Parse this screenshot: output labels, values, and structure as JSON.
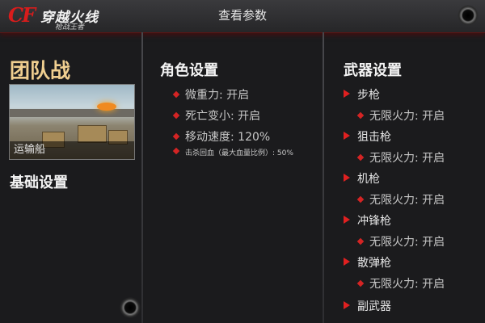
{
  "header": {
    "title": "查看参数",
    "logo_text": "穿越火线",
    "logo_sub": "枪战王者"
  },
  "mode": {
    "name": "团队战",
    "map_name": "运输船"
  },
  "basic_settings": {
    "title": "基础设置"
  },
  "role_settings": {
    "title": "角色设置",
    "items": [
      "微重力: 开启",
      "死亡变小: 开启",
      "移动速度: 120%",
      "击杀回血（最大血量比例）: 50%"
    ]
  },
  "weapon_settings": {
    "title": "武器设置",
    "weapons": [
      {
        "name": "步枪",
        "option": "无限火力: 开启"
      },
      {
        "name": "狙击枪",
        "option": "无限火力: 开启"
      },
      {
        "name": "机枪",
        "option": "无限火力: 开启"
      },
      {
        "name": "冲锋枪",
        "option": "无限火力: 开启"
      },
      {
        "name": "散弹枪",
        "option": "无限火力: 开启"
      },
      {
        "name": "副武器",
        "option": ""
      }
    ]
  }
}
